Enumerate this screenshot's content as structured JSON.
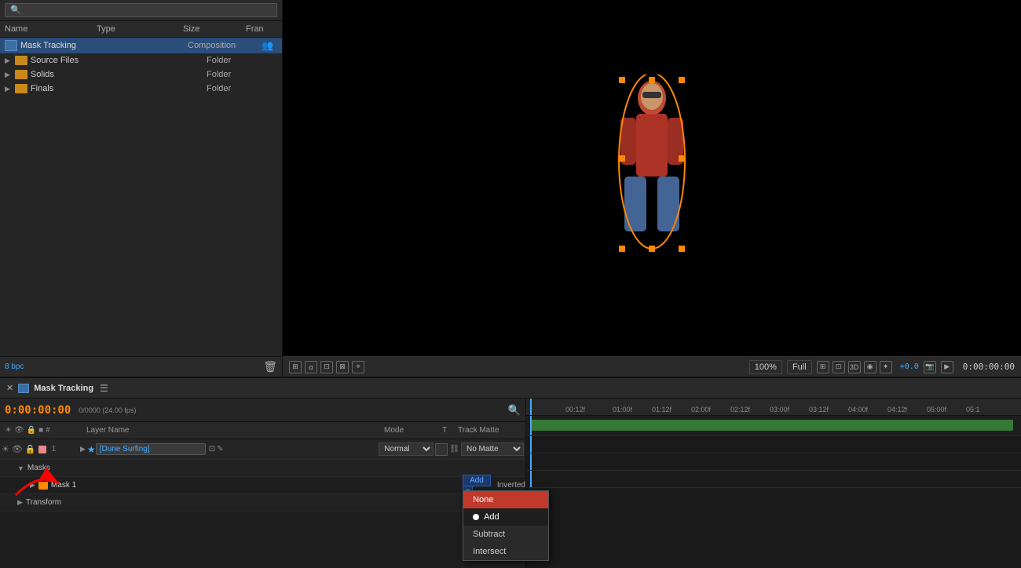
{
  "project_panel": {
    "search_placeholder": "🔍",
    "headers": {
      "name": "Name",
      "type": "Type",
      "size": "Size",
      "fran": "Fran"
    },
    "items": [
      {
        "name": "Mask Tracking",
        "type": "Composition",
        "is_comp": true,
        "indent": 0
      },
      {
        "name": "Source Files",
        "type": "Folder",
        "is_comp": false,
        "indent": 0
      },
      {
        "name": "Solids",
        "type": "Folder",
        "is_comp": false,
        "indent": 0
      },
      {
        "name": "Finals",
        "type": "Folder",
        "is_comp": false,
        "indent": 0
      }
    ]
  },
  "preview": {
    "zoom": "100%",
    "quality": "Full",
    "timecode_display": "0:00:00:00"
  },
  "timeline": {
    "title": "Mask Tracking",
    "timecode": "0:00:00:00",
    "timecode_sub": "0/0000 (24.00 fps)",
    "layer_headers": {
      "mode": "Mode",
      "t": "T",
      "track_matte": "Track Matte"
    },
    "layers": [
      {
        "num": "1",
        "name": "[Dune Surfing]",
        "mode": "Normal",
        "track_matte": "No Matte"
      }
    ],
    "masks_label": "Masks",
    "mask1_label": "Mask 1",
    "mask1_mode": "Add",
    "mask1_inverted": "Inverted",
    "transform_label": "Transform",
    "ruler_marks": [
      "00:12f",
      "01:00f",
      "01:12f",
      "02:00f",
      "02:12f",
      "03:00f",
      "03:12f",
      "04:00f",
      "04:12f",
      "05:00f",
      "05:1"
    ]
  },
  "dropdown": {
    "items": [
      {
        "label": "None",
        "highlighted": true,
        "has_dot": false
      },
      {
        "label": "Add",
        "highlighted": false,
        "has_dot": true,
        "active": true
      },
      {
        "label": "Subtract",
        "highlighted": false,
        "has_dot": false
      },
      {
        "label": "Intersect",
        "highlighted": false,
        "has_dot": false
      }
    ]
  },
  "icons": {
    "eye": "👁",
    "lock": "🔒",
    "gear": "⚙",
    "folder": "📁",
    "comp": "🎬",
    "arrow_right": "▶",
    "arrow_down": "▼",
    "search": "🔍",
    "plus": "+",
    "minus": "−",
    "close": "✕",
    "chevron_down": "▾"
  }
}
